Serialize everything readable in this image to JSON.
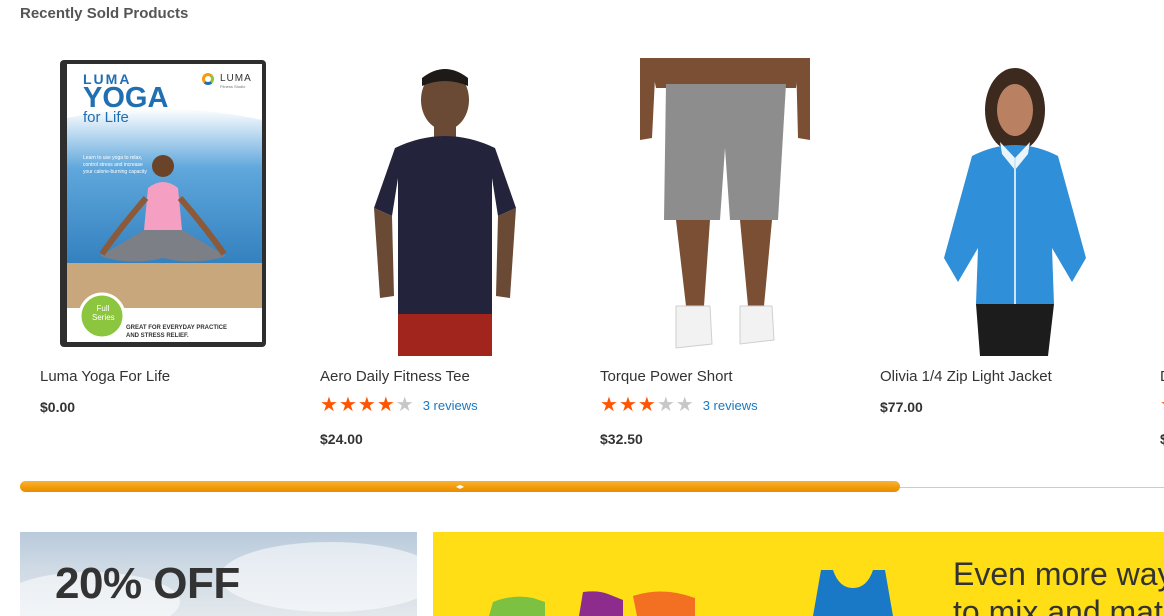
{
  "section": {
    "title": "Recently Sold Products"
  },
  "products": [
    {
      "name": "Luma Yoga For Life",
      "price": "$0.00",
      "has_rating": false,
      "dvd": {
        "brand": "LUMA",
        "title_line1": "YOGA",
        "title_line2": "for Life",
        "logo_text": "LUMA",
        "logo_sub": "Fitness Studio",
        "blurb": "Learn to use yoga to relax, control stress and increase your calorie-burning capacity",
        "badge_line1": "Full",
        "badge_line2": "Series",
        "footer_line1": "GREAT FOR EVERYDAY PRACTICE",
        "footer_line2": "AND STRESS RELIEF."
      }
    },
    {
      "name": "Aero Daily Fitness Tee",
      "price": "$24.00",
      "has_rating": true,
      "rating": 4,
      "reviews": "3 reviews"
    },
    {
      "name": "Torque Power Short",
      "price": "$32.50",
      "has_rating": true,
      "rating": 3,
      "reviews": "3 reviews"
    },
    {
      "name": "Olivia 1/4 Zip Light Jacket",
      "price": "$77.00",
      "has_rating": false
    },
    {
      "name": "D",
      "price": "$",
      "has_rating": true,
      "rating": 1,
      "reviews": ""
    }
  ],
  "scrollbar": {
    "position": 0,
    "visible_fraction": 0.77
  },
  "banners": {
    "left": {
      "headline": "20% OFF"
    },
    "right": {
      "line1": "Even more way",
      "line2": "to mix and mat"
    }
  },
  "colors": {
    "accent": "#ff5501",
    "link": "#1979c3",
    "banner_yellow": "#ffde16",
    "scroll_thumb": "#f39c0c"
  }
}
